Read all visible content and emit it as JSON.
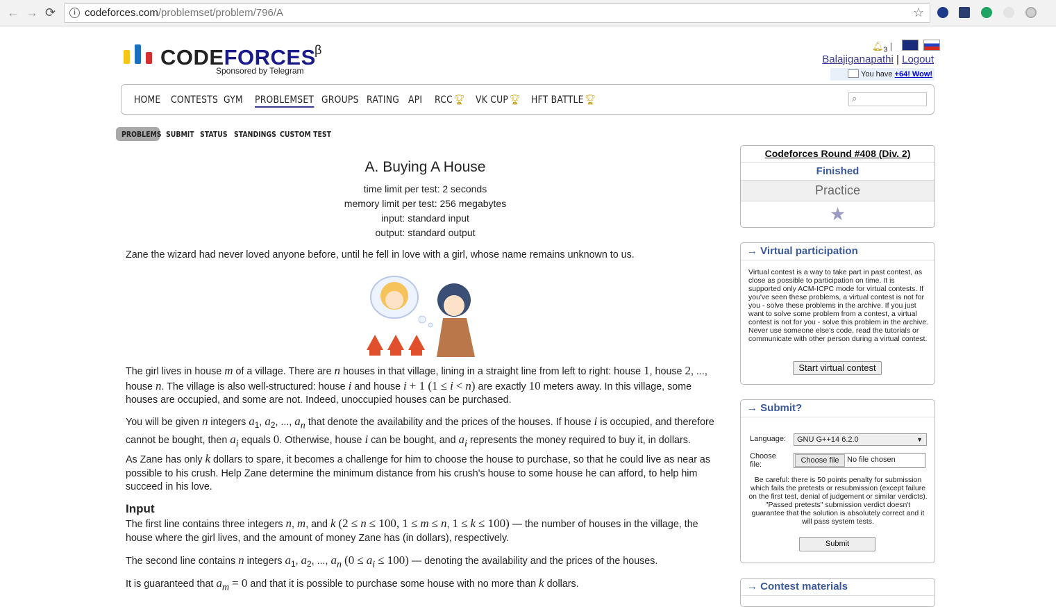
{
  "browser": {
    "url_host": "codeforces.com",
    "url_path": "/problemset/problem/796/A"
  },
  "header": {
    "logo_code": "CODE",
    "logo_forces": "FORCES",
    "logo_beta": "β",
    "sponsor": "Sponsored by Telegram",
    "notify_count": "3",
    "username": "Balajiganapathi",
    "separator": "|",
    "logout": "Logout",
    "messages_prefix": "You have",
    "messages_link": "+64! Wow!"
  },
  "menu": {
    "items": [
      "HOME",
      "CONTESTS",
      "GYM",
      "PROBLEMSET",
      "GROUPS",
      "RATING",
      "API",
      "RCC",
      "VK CUP",
      "HFT BATTLE"
    ],
    "active": "PROBLEMSET"
  },
  "submenu": [
    "PROBLEMS",
    "SUBMIT",
    "STATUS",
    "STANDINGS",
    "CUSTOM TEST"
  ],
  "problem": {
    "title": "A. Buying A House",
    "time_limit": "time limit per test: 2 seconds",
    "memory_limit": "memory limit per test: 256 megabytes",
    "input": "input: standard input",
    "output": "output: standard output",
    "intro": "Zane the wizard had never loved anyone before, until he fell in love with a girl, whose name remains unknown to us.",
    "input_title": "Input"
  },
  "sidebar": {
    "round_title": "Codeforces Round #408 (Div. 2)",
    "status": "Finished",
    "practice": "Practice",
    "vp_title": "→ Virtual participation",
    "vp_text": "Virtual contest is a way to take part in past contest, as close as possible to participation on time. It is supported only ACM-ICPC mode for virtual contests. If you've seen these problems, a virtual contest is not for you - solve these problems in the archive. If you just want to solve some problem from a contest, a virtual contest is not for you - solve this problem in the archive. Never use someone else's code, read the tutorials or communicate with other person during a virtual contest.",
    "vp_button": "Start virtual contest",
    "submit_title": "→ Submit?",
    "language_label": "Language:",
    "language_value": "GNU G++14 6.2.0",
    "file_label": "Choose file:",
    "file_button": "Choose file",
    "file_status": "No file chosen",
    "careful": "Be careful: there is 50 points penalty for submission which fails the pretests or resubmission (except failure on the first test, denial of judgement or similar verdicts). \"Passed pretests\" submission verdict doesn't guarantee that the solution is absolutely correct and it will pass system tests.",
    "submit_button": "Submit",
    "materials_title": "→ Contest materials"
  }
}
